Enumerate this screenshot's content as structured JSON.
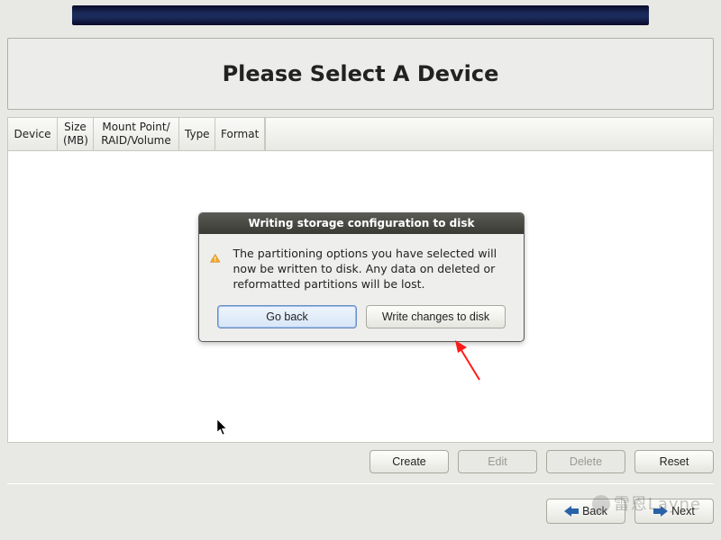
{
  "title": "Please Select A Device",
  "columns": {
    "device": "Device",
    "size": "Size\n(MB)",
    "mount": "Mount Point/\nRAID/Volume",
    "type": "Type",
    "format": "Format"
  },
  "dialog": {
    "title": "Writing storage configuration to disk",
    "message": "The partitioning options you have selected will now be written to disk.  Any data on deleted or reformatted partitions will be lost.",
    "go_back": "Go back",
    "write": "Write changes to disk"
  },
  "actions": {
    "create": "Create",
    "edit": "Edit",
    "delete": "Delete",
    "reset": "Reset"
  },
  "nav": {
    "back": "Back",
    "next": "Next"
  },
  "watermark": "雷恩Layne"
}
